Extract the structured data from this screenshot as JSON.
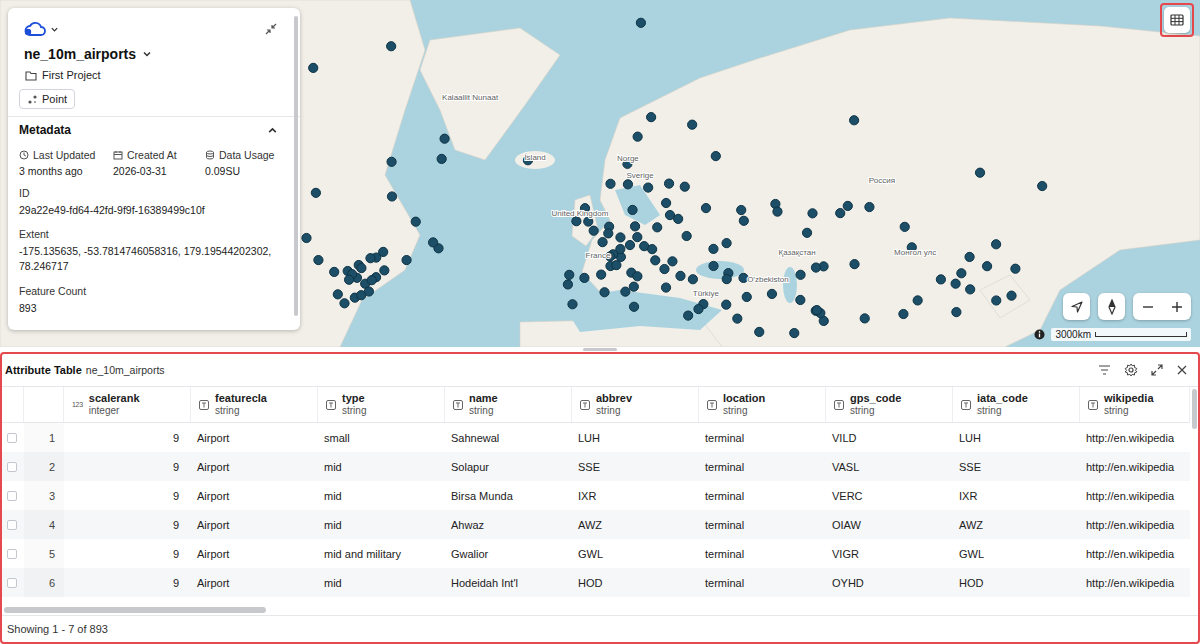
{
  "map": {
    "labels": [
      {
        "text": "Kalaallit Nunaat",
        "lon": -42.1,
        "lat": 71.6
      },
      {
        "text": "Ísland",
        "lon": -20.2,
        "lat": 64.0
      },
      {
        "text": "Norge",
        "lon": 11.1,
        "lat": 63.9
      },
      {
        "text": "Sverige",
        "lon": 15.2,
        "lat": 61.2
      },
      {
        "text": "United Kingdom",
        "lon": -5.1,
        "lat": 54.4
      },
      {
        "text": "France",
        "lon": 1.0,
        "lat": 45.4
      },
      {
        "text": "Россия",
        "lon": 96.7,
        "lat": 60.4
      },
      {
        "text": "Қазақстан",
        "lon": 68.1,
        "lat": 46.0
      },
      {
        "text": "O'zbekiston",
        "lon": 58.3,
        "lat": 39.3
      },
      {
        "text": "Монгол улс",
        "lon": 107.9,
        "lat": 46.0
      },
      {
        "text": "Türkiye",
        "lon": 37.4,
        "lat": 35.6
      }
    ],
    "airports": [
      [
        -0.45,
        51.47
      ],
      [
        2.55,
        49.0
      ],
      [
        8.57,
        50.03
      ],
      [
        4.76,
        52.31
      ],
      [
        -3.57,
        40.47
      ],
      [
        2.08,
        41.3
      ],
      [
        12.25,
        41.8
      ],
      [
        8.72,
        45.63
      ],
      [
        11.79,
        48.35
      ],
      [
        16.57,
        48.11
      ],
      [
        13.5,
        52.37
      ],
      [
        20.97,
        52.17
      ],
      [
        14.26,
        50.1
      ],
      [
        19.26,
        47.43
      ],
      [
        8.55,
        47.46
      ],
      [
        6.11,
        46.24
      ],
      [
        4.48,
        50.9
      ],
      [
        -6.27,
        53.42
      ],
      [
        -2.27,
        53.35
      ],
      [
        -3.37,
        55.95
      ],
      [
        12.65,
        55.62
      ],
      [
        11.1,
        60.2
      ],
      [
        17.92,
        59.65
      ],
      [
        24.96,
        60.32
      ],
      [
        23.97,
        56.92
      ],
      [
        25.28,
        54.63
      ],
      [
        30.89,
        50.34
      ],
      [
        28.03,
        53.88
      ],
      [
        37.41,
        55.97
      ],
      [
        30.26,
        59.8
      ],
      [
        28.81,
        40.98
      ],
      [
        32.99,
        40.12
      ],
      [
        23.94,
        37.94
      ],
      [
        26.1,
        44.57
      ],
      [
        23.41,
        42.7
      ],
      [
        20.31,
        44.82
      ],
      [
        -9.13,
        38.77
      ],
      [
        -8.68,
        41.24
      ],
      [
        5.22,
        43.44
      ],
      [
        5.08,
        45.73
      ],
      [
        7.21,
        43.66
      ],
      [
        14.29,
        40.88
      ],
      [
        13.09,
        38.18
      ],
      [
        18.92,
        69.68
      ],
      [
        14.37,
        67.27
      ],
      [
        10.92,
        63.46
      ],
      [
        5.22,
        60.29
      ],
      [
        -22.6,
        63.99
      ],
      [
        -51.68,
        64.19
      ],
      [
        -50.7,
        67.0
      ],
      [
        32.75,
        68.78
      ],
      [
        40.72,
        64.6
      ],
      [
        49.28,
        55.6
      ],
      [
        50.16,
        53.5
      ],
      [
        44.35,
        48.78
      ],
      [
        39.92,
        47.49
      ],
      [
        39.95,
        43.45
      ],
      [
        44.95,
        41.67
      ],
      [
        50.05,
        40.47
      ],
      [
        44.4,
        40.15
      ],
      [
        51.15,
        35.41
      ],
      [
        59.64,
        36.23
      ],
      [
        69.28,
        41.26
      ],
      [
        77.04,
        43.35
      ],
      [
        71.47,
        51.02
      ],
      [
        74.48,
        43.06
      ],
      [
        60.8,
        56.74
      ],
      [
        61.5,
        55.3
      ],
      [
        73.31,
        54.97
      ],
      [
        82.65,
        55.01
      ],
      [
        85.2,
        56.38
      ],
      [
        92.49,
        56.17
      ],
      [
        104.39,
        52.27
      ],
      [
        106.77,
        47.84
      ],
      [
        129.77,
        62.09
      ],
      [
        87.33,
        69.31
      ],
      [
        135.19,
        48.53
      ],
      [
        132.15,
        43.4
      ],
      [
        150.72,
        59.91
      ],
      [
        116.58,
        40.08
      ],
      [
        121.8,
        31.14
      ],
      [
        126.25,
        45.62
      ],
      [
        123.48,
        41.64
      ],
      [
        121.54,
        38.97
      ],
      [
        126.45,
        37.46
      ],
      [
        140.39,
        35.76
      ],
      [
        135.24,
        34.43
      ],
      [
        141.69,
        42.78
      ],
      [
        108.75,
        34.45
      ],
      [
        87.47,
        43.9
      ],
      [
        90.91,
        29.3
      ],
      [
        103.95,
        30.58
      ],
      [
        77.1,
        28.56
      ],
      [
        74.4,
        31.52
      ],
      [
        69.21,
        34.57
      ],
      [
        67.16,
        24.9
      ],
      [
        31.4,
        30.12
      ],
      [
        10.23,
        36.85
      ],
      [
        3.21,
        36.69
      ],
      [
        13.16,
        32.66
      ],
      [
        44.23,
        33.26
      ],
      [
        36.52,
        33.41
      ],
      [
        55.36,
        25.25
      ],
      [
        47.97,
        29.24
      ],
      [
        34.88,
        32.0
      ],
      [
        -7.59,
        33.37
      ],
      [
        75.95,
        30.85
      ],
      [
        74.8,
        31.7
      ],
      [
        15.47,
        78.25
      ],
      [
        -73.78,
        40.64
      ],
      [
        -71.0,
        42.36
      ],
      [
        -87.9,
        41.98
      ],
      [
        -79.63,
        43.68
      ],
      [
        -73.74,
        45.47
      ],
      [
        -77.46,
        38.95
      ],
      [
        -83.35,
        42.21
      ],
      [
        -75.24,
        39.87
      ],
      [
        -80.23,
        40.49
      ],
      [
        -84.43,
        33.64
      ],
      [
        -80.94,
        35.21
      ],
      [
        -75.67,
        45.32
      ],
      [
        -71.39,
        46.79
      ],
      [
        -63.51,
        44.88
      ],
      [
        -52.75,
        47.62
      ],
      [
        -54.57,
        48.94
      ],
      [
        -60.42,
        53.32
      ],
      [
        -68.56,
        63.76
      ],
      [
        -93.22,
        44.88
      ],
      [
        -97.24,
        49.91
      ],
      [
        -68.7,
        76.53
      ],
      [
        -94.97,
        74.72
      ],
      [
        -94.07,
        58.74
      ],
      [
        -68.42,
        58.1
      ],
      [
        -81.85,
        41.41
      ],
      [
        -82.89,
        39.99
      ],
      [
        -86.68,
        36.12
      ],
      [
        -78.79,
        35.88
      ],
      [
        -76.2,
        36.89
      ],
      [
        -78.73,
        42.94
      ]
    ],
    "scale": "3000km"
  },
  "layer_panel": {
    "title": "ne_10m_airports",
    "project": "First Project",
    "geometry": "Point",
    "section": {
      "title": "Metadata",
      "expanded": true
    },
    "stats": [
      {
        "label": "Last Updated",
        "value": "3 months ago"
      },
      {
        "label": "Created At",
        "value": "2026-03-31"
      },
      {
        "label": "Data Usage",
        "value": "0.09SU"
      }
    ],
    "fields": [
      {
        "label": "ID",
        "value": "29a22e49-fd64-42fd-9f9f-16389499c10f"
      },
      {
        "label": "Extent",
        "value": "-175.135635, -53.7814746058316, 179.19544202302, 78.246717"
      },
      {
        "label": "Feature Count",
        "value": "893"
      }
    ]
  },
  "table_toggle": {
    "selected": true
  },
  "attribute_table": {
    "title": "Attribute Table",
    "layer": "ne_10m_airports",
    "columns": [
      {
        "name": "scalerank",
        "type": "integer",
        "type_icon": "123"
      },
      {
        "name": "featurecla",
        "type": "string"
      },
      {
        "name": "type",
        "type": "string"
      },
      {
        "name": "name",
        "type": "string"
      },
      {
        "name": "abbrev",
        "type": "string"
      },
      {
        "name": "location",
        "type": "string"
      },
      {
        "name": "gps_code",
        "type": "string"
      },
      {
        "name": "iata_code",
        "type": "string"
      },
      {
        "name": "wikipedia",
        "type": "string"
      }
    ],
    "rows": [
      {
        "number": "1",
        "selected": false,
        "cells": [
          "9",
          "Airport",
          "small",
          "Sahnewal",
          "LUH",
          "terminal",
          "VILD",
          "LUH",
          "http://en.wikipedia"
        ]
      },
      {
        "number": "2",
        "selected": false,
        "cells": [
          "9",
          "Airport",
          "mid",
          "Solapur",
          "SSE",
          "terminal",
          "VASL",
          "SSE",
          "http://en.wikipedia"
        ]
      },
      {
        "number": "3",
        "selected": false,
        "cells": [
          "9",
          "Airport",
          "mid",
          "Birsa Munda",
          "IXR",
          "terminal",
          "VERC",
          "IXR",
          "http://en.wikipedia"
        ]
      },
      {
        "number": "4",
        "selected": false,
        "cells": [
          "9",
          "Airport",
          "mid",
          "Ahwaz",
          "AWZ",
          "terminal",
          "OIAW",
          "AWZ",
          "http://en.wikipedia"
        ]
      },
      {
        "number": "5",
        "selected": false,
        "cells": [
          "9",
          "Airport",
          "mid and military",
          "Gwalior",
          "GWL",
          "terminal",
          "VIGR",
          "GWL",
          "http://en.wikipedia"
        ]
      },
      {
        "number": "6",
        "selected": false,
        "cells": [
          "9",
          "Airport",
          "mid",
          "Hodeidah Int'l",
          "HOD",
          "terminal",
          "OYHD",
          "HOD",
          "http://en.wikipedia"
        ]
      }
    ],
    "status": "Showing 1 - 7 of 893"
  }
}
